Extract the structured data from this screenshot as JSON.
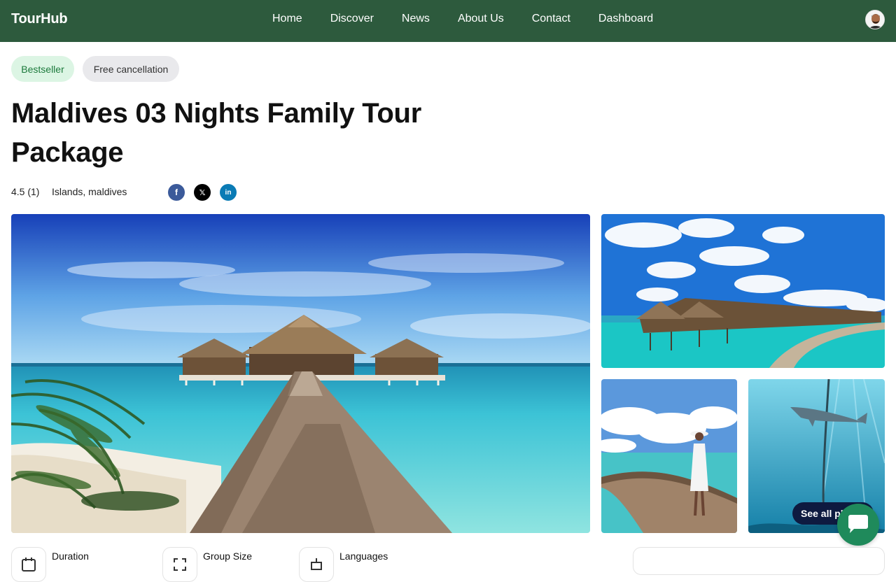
{
  "header": {
    "logo": "TourHub",
    "nav": [
      "Home",
      "Discover",
      "News",
      "About Us",
      "Contact",
      "Dashboard"
    ]
  },
  "badges": {
    "bestseller": "Bestseller",
    "free_cancellation": "Free cancellation"
  },
  "tour": {
    "title": "Maldives 03 Nights Family Tour Package",
    "rating": "4.5 (1)",
    "location": "Islands, maldives"
  },
  "social": {
    "facebook": "f",
    "x": "𝕏",
    "linkedin": "in"
  },
  "gallery": {
    "see_all": "See all ph"
  },
  "info": {
    "duration": "Duration",
    "group_size": "Group Size",
    "languages": "Languages"
  },
  "colors": {
    "header_bg": "#2d5a3d",
    "accent_green": "#1f8a5b",
    "badge_green_bg": "#dcf5e4"
  }
}
